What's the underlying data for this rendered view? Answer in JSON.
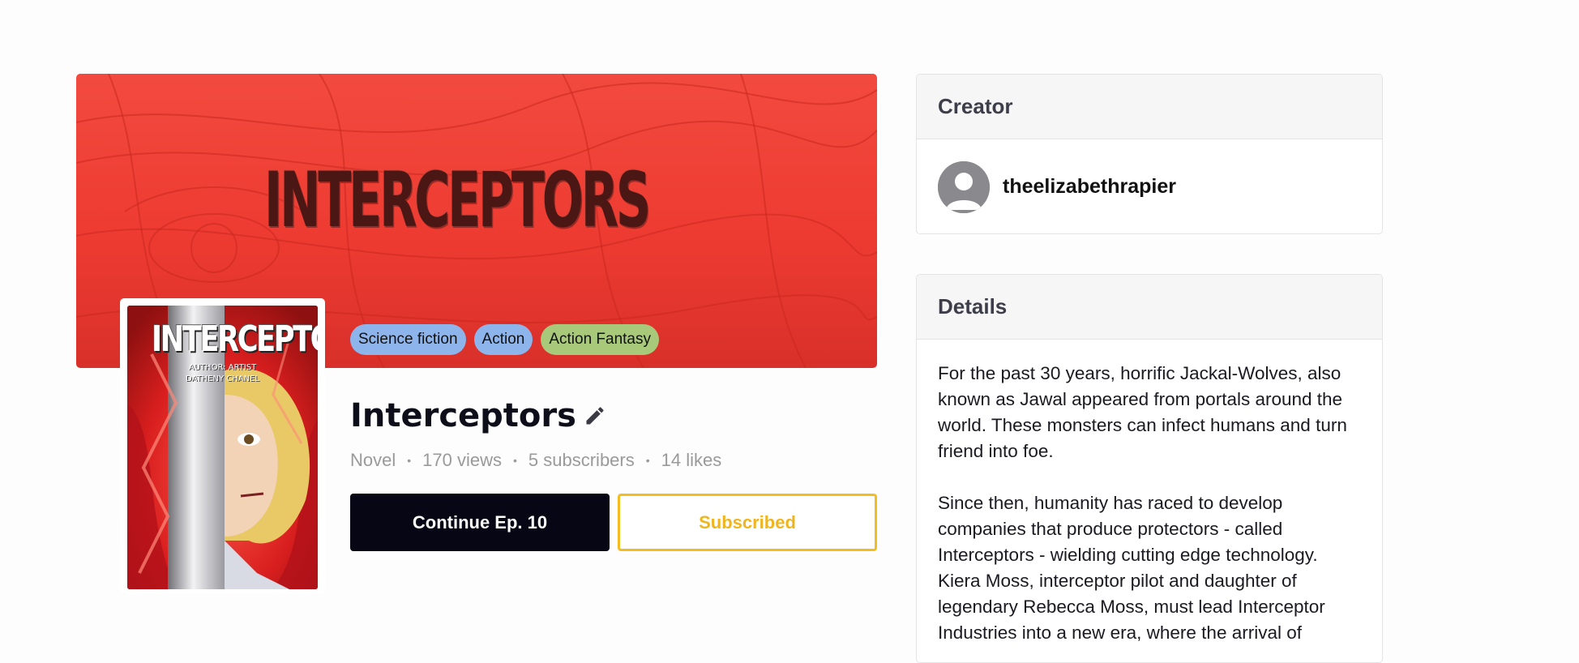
{
  "banner": {
    "title": "INTERCEPTORS",
    "tags": [
      {
        "label": "Science fiction",
        "color": "#8eb4ec"
      },
      {
        "label": "Action",
        "color": "#8eb4ec"
      },
      {
        "label": "Action Fantasy",
        "color": "#a8c97a"
      }
    ]
  },
  "cover": {
    "title": "INTERCEPTORS",
    "subtitle_line1": "AUTHOR: ARTIST",
    "subtitle_line2": "DATHENY CHANEL"
  },
  "comic": {
    "title": "Interceptors",
    "type": "Novel",
    "views": "170 views",
    "subscribers": "5 subscribers",
    "likes": "14 likes"
  },
  "actions": {
    "continue_label": "Continue Ep. 10",
    "subscribed_label": "Subscribed"
  },
  "creator": {
    "heading": "Creator",
    "name": "theelizabethrapier"
  },
  "details": {
    "heading": "Details",
    "paragraph1": "For the past 30 years, horrific Jackal-Wolves, also known as Jawal appeared from portals around the world. These monsters can infect humans and turn friend into foe.",
    "paragraph2": "Since then, humanity has raced to develop companies that produce protectors - called Interceptors - wielding cutting edge technology. Kiera Moss, interceptor pilot and daughter of legendary Rebecca Moss, must lead Interceptor Industries into a new era, where the arrival of"
  },
  "colors": {
    "accent_gold": "#f3bd22",
    "dark_button": "#060615",
    "banner_red": "#ee3b31"
  }
}
